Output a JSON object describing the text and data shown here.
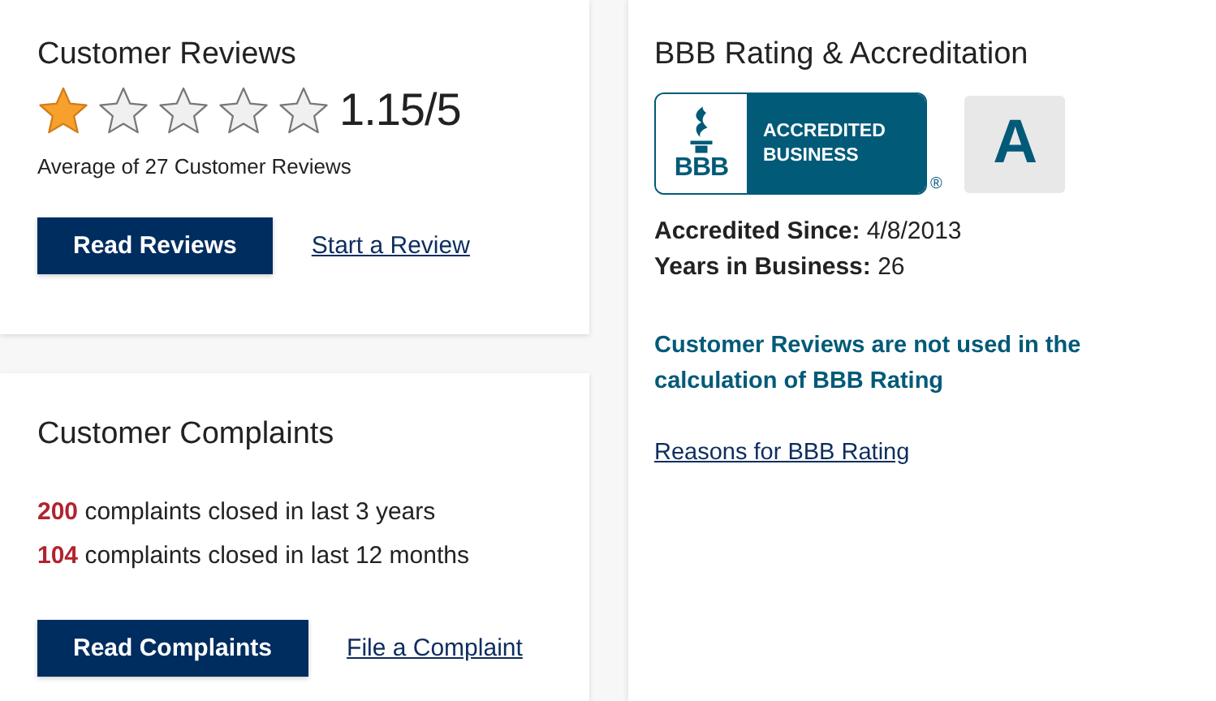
{
  "reviews": {
    "title": "Customer Reviews",
    "stars": 1,
    "rating": "1.15/5",
    "summary": "Average of 27 Customer Reviews",
    "primary_button": "Read Reviews",
    "link": "Start a Review"
  },
  "complaints": {
    "title": "Customer Complaints",
    "lines": [
      "**200** complaints closed in last 3 years",
      "**104** complaints closed in last 12 months"
    ],
    "primary_button": "Read Complaints",
    "link": "File a Complaint"
  },
  "rating": {
    "title": "BBB Rating & Accreditation",
    "seal": {
      "mark": "BBB",
      "text_lines": [
        "ACCREDITED",
        "BUSINESS"
      ],
      "registered": "®"
    },
    "grade": "A",
    "facts": [
      "**Accredited Since:** 4/8/2013",
      "**Years in Business:** 26"
    ],
    "note": "Customer Reviews are not used in the calculation of BBB Rating",
    "link": "Reasons for BBB Rating"
  }
}
